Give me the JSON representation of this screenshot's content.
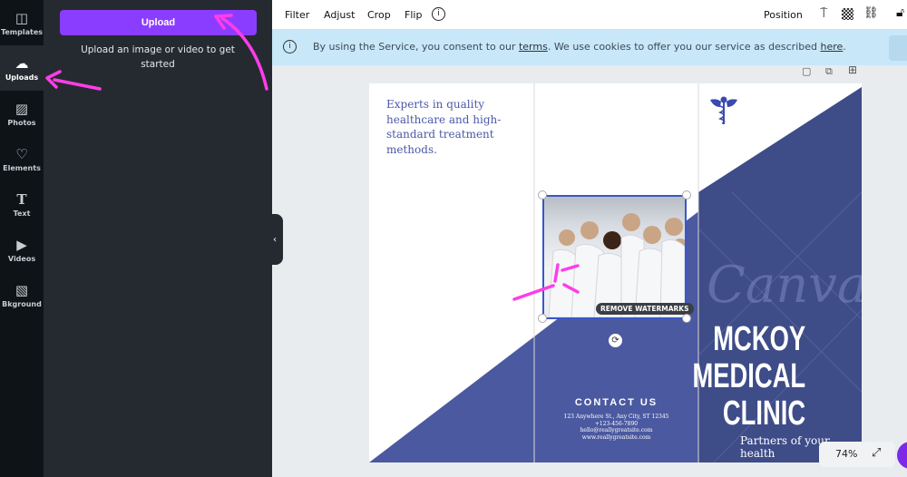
{
  "sidebar": {
    "items": [
      {
        "label": "Templates",
        "icon": "template-icon",
        "glyph": "◫"
      },
      {
        "label": "Uploads",
        "icon": "cloud-upload-icon",
        "glyph": "☁"
      },
      {
        "label": "Photos",
        "icon": "photo-icon",
        "glyph": "▨"
      },
      {
        "label": "Elements",
        "icon": "shapes-icon",
        "glyph": "♡"
      },
      {
        "label": "Text",
        "icon": "text-icon",
        "glyph": "T"
      },
      {
        "label": "Videos",
        "icon": "video-icon",
        "glyph": "▶"
      },
      {
        "label": "Bkground",
        "icon": "background-icon",
        "glyph": "▧"
      }
    ],
    "active": "Uploads"
  },
  "panel": {
    "upload_label": "Upload",
    "hint": "Upload an image or video to get started"
  },
  "toolbar": {
    "filter": "Filter",
    "adjust": "Adjust",
    "crop": "Crop",
    "flip": "Flip",
    "position": "Position"
  },
  "banner": {
    "text_before": "By using the Service, you consent to our ",
    "terms": "terms",
    "text_middle": ". We use cookies to offer you our service as described ",
    "here": "here",
    "text_after": "."
  },
  "design": {
    "lead": "Experts in quality healthcare and high-standard treatment methods.",
    "watermark_button": "REMOVE WATERMARKS",
    "watermark": "Canva",
    "contact_title": "CONTACT US",
    "contact_lines": [
      "123 Anywhere St., Any City, ST 12345",
      "+123-456-7890",
      "hello@reallygreatsite.com",
      "www.reallygreatsite.com"
    ],
    "title_lines": [
      "MCKOY",
      "MEDICAL",
      "CLINIC"
    ],
    "tagline": "Partners of your health",
    "accent": "#4b59a0"
  },
  "zoom": {
    "level": "74%"
  },
  "colors": {
    "brand": "#8b3dff",
    "annotation": "#ff3de8"
  }
}
